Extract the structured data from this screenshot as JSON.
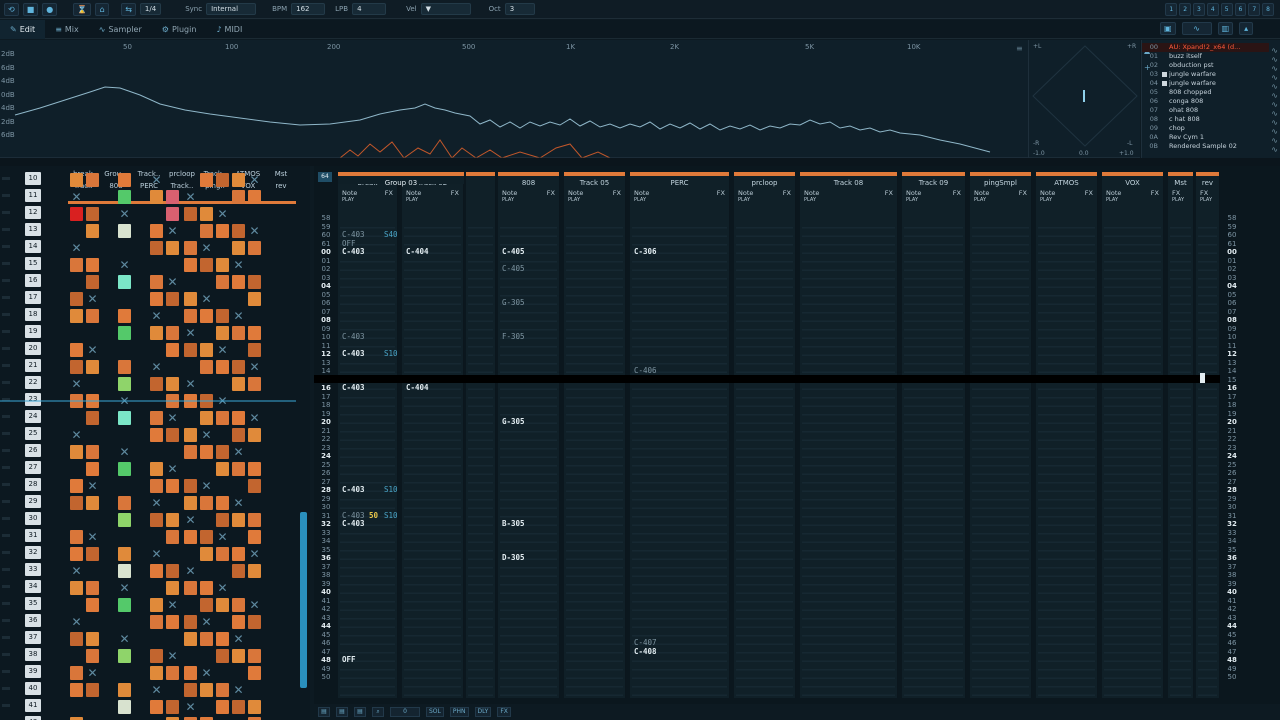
{
  "toolbar": {
    "grid": "1/4",
    "sync_label": "Sync",
    "sync_value": "Internal",
    "bpm_label": "BPM",
    "bpm_value": "162",
    "lpb_label": "LPB",
    "lpb_value": "4",
    "vel_label": "Vel",
    "oct_label": "Oct",
    "oct_value": "3",
    "right_numbers": [
      "1",
      "2",
      "3",
      "4",
      "5",
      "6",
      "7",
      "8"
    ]
  },
  "tabs": [
    {
      "label": "Edit",
      "icon": "edit-icon"
    },
    {
      "label": "Mix",
      "icon": "mix-icon"
    },
    {
      "label": "Sampler",
      "icon": "sampler-icon"
    },
    {
      "label": "Plugin",
      "icon": "plugin-icon"
    },
    {
      "label": "MIDI",
      "icon": "midi-icon"
    }
  ],
  "analyzer": {
    "db_labels": [
      "2dB",
      "6dB",
      "4dB",
      "0dB",
      "4dB",
      "2dB",
      "6dB"
    ],
    "freq_labels": [
      "50",
      "100",
      "200",
      "500",
      "1K",
      "2K",
      "5K",
      "10K"
    ],
    "stereo_labels": [
      "+L",
      "+R",
      "-R",
      "-L",
      "-1.0",
      "0.0",
      "+1.0"
    ]
  },
  "machines": {
    "items": [
      {
        "num": "00",
        "name": "AU: Xpand!2_x64 (d...",
        "selected": true
      },
      {
        "num": "01",
        "name": "buzz itself"
      },
      {
        "num": "02",
        "name": "obduction pst"
      },
      {
        "num": "03",
        "name": "jungle warfare",
        "square": true
      },
      {
        "num": "04",
        "name": "jungle warfare",
        "square": true
      },
      {
        "num": "05",
        "name": "808 chopped"
      },
      {
        "num": "06",
        "name": "conga 808"
      },
      {
        "num": "07",
        "name": "ohat 808"
      },
      {
        "num": "08",
        "name": "c hat 808"
      },
      {
        "num": "09",
        "name": "chop"
      },
      {
        "num": "0A",
        "name": "Rev Cym 1"
      },
      {
        "num": "0B",
        "name": "Rendered Sample 02"
      }
    ]
  },
  "sequencer": {
    "headers": [
      {
        "top": "break",
        "bottom": "Track"
      },
      {
        "top": "Grou...",
        "bottom": "808"
      },
      {
        "top": "Track..",
        "bottom": "PERC"
      },
      {
        "top": "prcloop",
        "bottom": "Track.."
      },
      {
        "top": "Track..",
        "bottom": "ping.."
      },
      {
        "top": "ATMOS",
        "bottom": "VOX"
      },
      {
        "top": "Mst",
        "bottom": "rev"
      }
    ],
    "row_numbers": [
      "10",
      "11",
      "12",
      "13",
      "14",
      "15",
      "16",
      "17",
      "18",
      "19",
      "20",
      "21",
      "22",
      "23",
      "24",
      "25",
      "26",
      "27",
      "28",
      "29",
      "30",
      "31",
      "32",
      "33",
      "34",
      "35",
      "36",
      "37",
      "38",
      "39",
      "40",
      "41",
      "42"
    ],
    "current_row": "23"
  },
  "pattern": {
    "pattern_number": "64",
    "group_label": "Group 03",
    "tracks": [
      {
        "name": "break",
        "sub": "Note",
        "fx": "FX"
      },
      {
        "name": "Track 02",
        "sub": "Note",
        "fx": "FX"
      },
      {
        "name": "808",
        "sub": "Note",
        "fx": "FX"
      },
      {
        "name": "Track 05",
        "sub": "Note",
        "fx": "FX"
      },
      {
        "name": "PERC",
        "sub": "Note",
        "fx": "FX"
      },
      {
        "name": "prcloop",
        "sub": "Note",
        "fx": "FX"
      },
      {
        "name": "Track 08",
        "sub": "Note",
        "fx": "FX"
      },
      {
        "name": "Track 09",
        "sub": "Note",
        "fx": "FX"
      },
      {
        "name": "pingSmpl",
        "sub": "Note",
        "fx": "FX"
      },
      {
        "name": "ATMOS",
        "sub": "Note",
        "fx": "FX"
      },
      {
        "name": "VOX",
        "sub": "Note",
        "fx": "FX"
      },
      {
        "name": "Mst",
        "sub": "FX",
        "fx": ""
      },
      {
        "name": "rev",
        "sub": "FX",
        "fx": ""
      }
    ],
    "notes": {
      "break": [
        {
          "row": "60",
          "text": "C-403",
          "fx": "S40",
          "dim": true
        },
        {
          "row": "OFF",
          "text": "OFF",
          "dim": true
        },
        {
          "row": "00",
          "text": "C-403"
        },
        {
          "row": "10",
          "text": "C-403",
          "dim": true
        },
        {
          "row": "12",
          "text": "C-403",
          "fx": "S10"
        },
        {
          "row": "16",
          "text": "C-403"
        },
        {
          "row": "28",
          "text": "C-403",
          "fx": "S10"
        },
        {
          "row": "31",
          "text": "C-403",
          "vel": "50",
          "fx": "S10",
          "dim": true
        },
        {
          "row": "32",
          "text": "C-403"
        },
        {
          "row": "48",
          "text": "OFF"
        }
      ],
      "track02": [
        {
          "row": "00",
          "text": "C-404"
        },
        {
          "row": "16",
          "text": "C-404"
        }
      ],
      "808": [
        {
          "row": "00",
          "text": "C-405"
        },
        {
          "row": "02",
          "text": "C-405",
          "dim": true
        },
        {
          "row": "06",
          "text": "G-305",
          "dim": true
        },
        {
          "row": "10",
          "text": "F-305",
          "dim": true
        },
        {
          "row": "20",
          "text": "G-305"
        },
        {
          "row": "32",
          "text": "B-305"
        },
        {
          "row": "36",
          "text": "D-305"
        }
      ],
      "perc": [
        {
          "row": "00",
          "text": "C-306"
        },
        {
          "row": "14",
          "text": "C-406",
          "dim": true
        },
        {
          "row": "46",
          "text": "C-407",
          "dim": true
        },
        {
          "row": "47",
          "text": "C-408"
        }
      ]
    },
    "row_labels": [
      "58",
      "59",
      "60",
      "61",
      "00",
      "01",
      "02",
      "03",
      "04",
      "05",
      "06",
      "07",
      "08",
      "09",
      "10",
      "11",
      "12",
      "13",
      "14",
      "15",
      "16",
      "17",
      "18",
      "19",
      "20",
      "21",
      "22",
      "23",
      "24",
      "25",
      "26",
      "27",
      "28",
      "29",
      "30",
      "31",
      "32",
      "33",
      "34",
      "35",
      "36",
      "37",
      "38",
      "39",
      "40",
      "41",
      "42",
      "43",
      "44",
      "45",
      "46",
      "47",
      "48",
      "49",
      "50"
    ],
    "current_row": "15",
    "play_label": "PLAY"
  },
  "colors": {
    "accent_orange": "#e07a3a",
    "accent_blue": "#2a8fbd",
    "selected_red": "#ff5a3a"
  },
  "bottom_toolbar": {
    "labels": [
      "SOL",
      "PHN",
      "DLY",
      "FX"
    ],
    "zero": "0"
  }
}
